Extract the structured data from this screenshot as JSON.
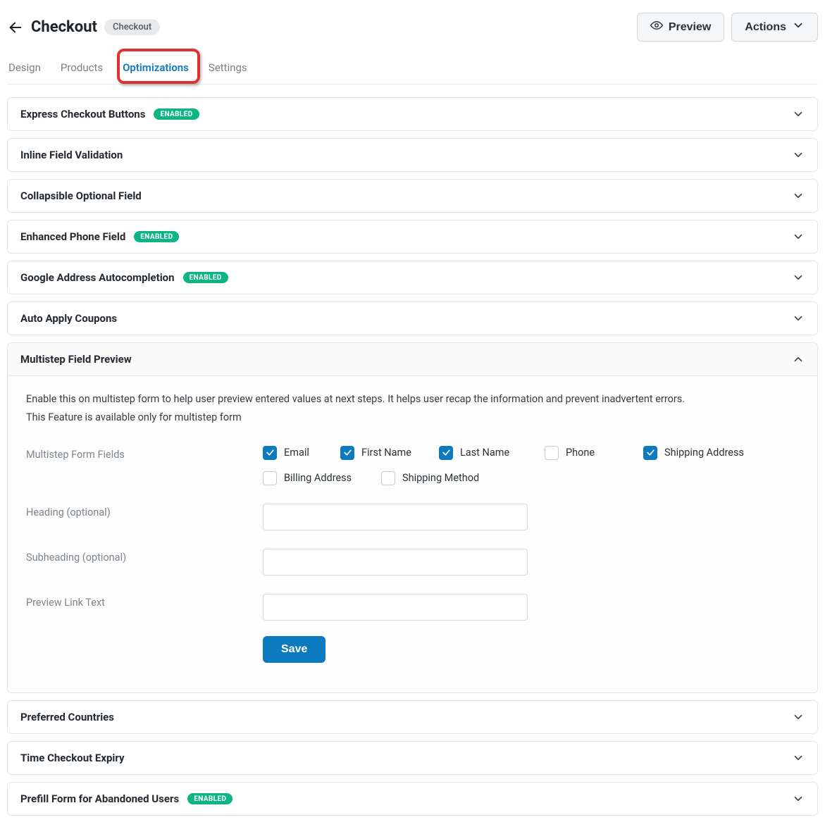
{
  "header": {
    "title": "Checkout",
    "badge": "Checkout",
    "preview_label": "Preview",
    "actions_label": "Actions"
  },
  "tabs": [
    {
      "id": "design",
      "label": "Design",
      "active": false
    },
    {
      "id": "products",
      "label": "Products",
      "active": false
    },
    {
      "id": "optimizations",
      "label": "Optimizations",
      "active": true
    },
    {
      "id": "settings",
      "label": "Settings",
      "active": false
    }
  ],
  "enabled_text": "ENABLED",
  "sections": {
    "express_checkout": {
      "title": "Express Checkout Buttons",
      "enabled": true
    },
    "inline_validation": {
      "title": "Inline Field Validation",
      "enabled": false
    },
    "collapsible": {
      "title": "Collapsible Optional Field",
      "enabled": false
    },
    "enhanced_phone": {
      "title": "Enhanced Phone Field",
      "enabled": true
    },
    "google_address": {
      "title": "Google Address Autocompletion",
      "enabled": true
    },
    "auto_apply": {
      "title": "Auto Apply Coupons",
      "enabled": false
    },
    "multistep": {
      "title": "Multistep Field Preview",
      "desc1": "Enable this on multistep form to help user preview entered values at next steps. It helps user recap the information and prevent inadvertent errors.",
      "desc2": "This Feature is available only for multistep form",
      "fields_label": "Multistep Form Fields",
      "checks": {
        "email": {
          "label": "Email",
          "checked": true
        },
        "first": {
          "label": "First Name",
          "checked": true
        },
        "last": {
          "label": "Last Name",
          "checked": true
        },
        "phone": {
          "label": "Phone",
          "checked": false
        },
        "ship": {
          "label": "Shipping Address",
          "checked": true
        },
        "bill": {
          "label": "Billing Address",
          "checked": false
        },
        "method": {
          "label": "Shipping Method",
          "checked": false
        }
      },
      "heading_label": "Heading (optional)",
      "subheading_label": "Subheading (optional)",
      "linktext_label": "Preview Link Text",
      "heading_value": "",
      "subheading_value": "",
      "linktext_value": "",
      "save_label": "Save"
    },
    "preferred_countries": {
      "title": "Preferred Countries",
      "enabled": false
    },
    "time_expiry": {
      "title": "Time Checkout Expiry",
      "enabled": false
    },
    "prefill": {
      "title": "Prefill Form for Abandoned Users",
      "enabled": true
    }
  }
}
